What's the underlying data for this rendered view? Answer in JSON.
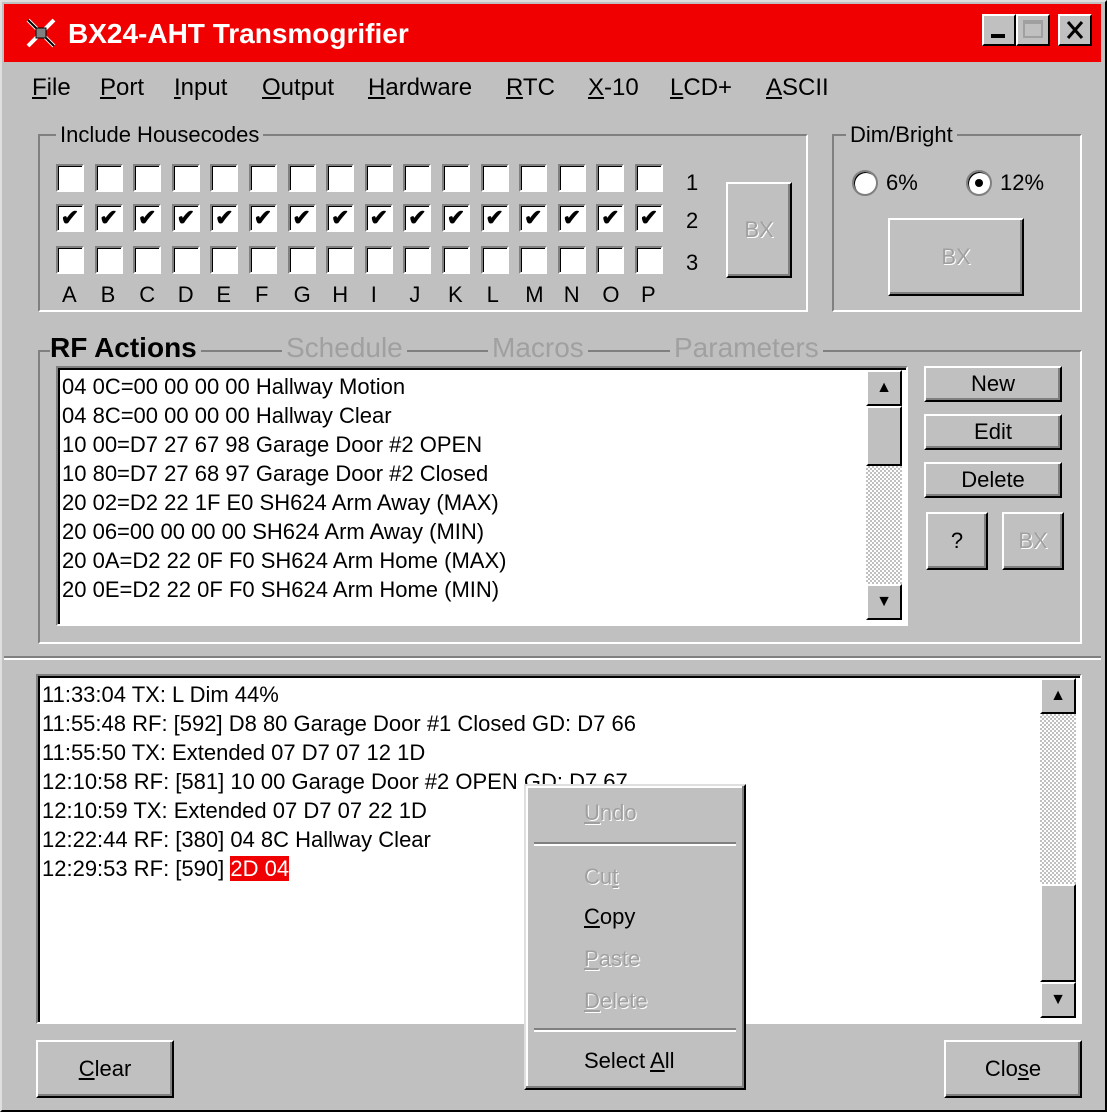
{
  "window": {
    "title": "BX24-AHT Transmogrifier",
    "accent_color": "#f00000",
    "buttons": [
      "minimize-icon",
      "maximize-icon",
      "close-icon"
    ]
  },
  "menu": [
    {
      "label": "File"
    },
    {
      "label": "Port"
    },
    {
      "label": "Input"
    },
    {
      "label": "Output"
    },
    {
      "label": "Hardware"
    },
    {
      "label": "RTC"
    },
    {
      "label": "X-10"
    },
    {
      "label": "LCD+"
    },
    {
      "label": "ASCII"
    }
  ],
  "housecodes": {
    "legend": "Include Housecodes",
    "row_labels": [
      "1",
      "2",
      "3"
    ],
    "columns": [
      "A",
      "B",
      "C",
      "D",
      "E",
      "F",
      "G",
      "H",
      "I",
      "J",
      "K",
      "L",
      "M",
      "N",
      "O",
      "P"
    ],
    "checked_row": "2",
    "bx_button": "BX"
  },
  "dimbright": {
    "legend": "Dim/Bright",
    "options": [
      "6%",
      "12%"
    ],
    "selected": "12%",
    "bx_button": "BX"
  },
  "tabs": {
    "active": "RF Actions",
    "others": [
      "Schedule",
      "Macros",
      "Parameters"
    ]
  },
  "rf_actions": {
    "items": [
      "04 0C=00 00 00 00 Hallway Motion",
      "04 8C=00 00 00 00 Hallway Clear",
      "10 00=D7 27 67 98 Garage Door #2 OPEN",
      "10 80=D7 27 68 97 Garage Door #2 Closed",
      "20 02=D2 22 1F E0 SH624 Arm Away (MAX)",
      "20 06=00 00 00 00 SH624 Arm Away (MIN)",
      "20 0A=D2 22 0F F0 SH624 Arm Home (MAX)",
      "20 0E=D2 22 0F F0 SH624 Arm Home (MIN)"
    ],
    "buttons": {
      "new": "New",
      "edit": "Edit",
      "delete": "Delete",
      "help": "?",
      "bx": "BX"
    }
  },
  "log": {
    "lines": [
      "11:33:04 TX: L Dim 44%",
      "11:55:48 RF: [592] D8 80 Garage Door #1 Closed GD: D7 66",
      "11:55:50 TX: Extended 07 D7 07 12 1D",
      "12:10:58 RF: [581] 10 00 Garage Door #2 OPEN GD: D7 67",
      "12:10:59 TX: Extended 07 D7 07 22 1D",
      "12:22:44 RF: [380] 04 8C Hallway Clear"
    ],
    "last_prefix": "12:29:53 RF: [590] ",
    "selected_text": "2D 04"
  },
  "context_menu": {
    "items": [
      {
        "label": "Undo",
        "enabled": false
      },
      {
        "label": "Cut",
        "enabled": false
      },
      {
        "label": "Copy",
        "enabled": true
      },
      {
        "label": "Paste",
        "enabled": false
      },
      {
        "label": "Delete",
        "enabled": false
      },
      {
        "label": "Select All",
        "enabled": true
      }
    ]
  },
  "footer": {
    "clear": "Clear",
    "close": "Close"
  }
}
